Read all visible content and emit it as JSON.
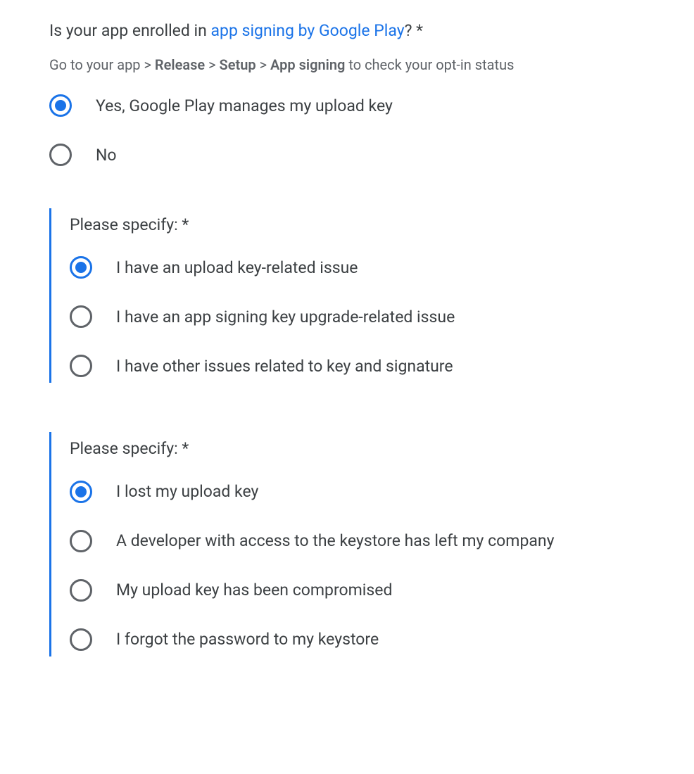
{
  "question1": {
    "title_prefix": "Is your app enrolled in ",
    "title_link": "app signing by Google Play",
    "title_suffix": "? *",
    "hint_prefix": "Go to your app > ",
    "hint_bold1": "Release",
    "hint_sep1": " > ",
    "hint_bold2": "Setup",
    "hint_sep2": " > ",
    "hint_bold3": "App signing",
    "hint_suffix": " to check your opt-in status",
    "options": [
      {
        "label": "Yes, Google Play manages my upload key",
        "selected": true
      },
      {
        "label": "No",
        "selected": false
      }
    ]
  },
  "question2": {
    "title": "Please specify: *",
    "options": [
      {
        "label": "I have an upload key-related issue",
        "selected": true
      },
      {
        "label": "I have an app signing key upgrade-related issue",
        "selected": false
      },
      {
        "label": "I have other issues related to key and signature",
        "selected": false
      }
    ]
  },
  "question3": {
    "title": "Please specify: *",
    "options": [
      {
        "label": "I lost my upload key",
        "selected": true
      },
      {
        "label": "A developer with access to the keystore has left my company",
        "selected": false
      },
      {
        "label": "My upload key has been compromised",
        "selected": false
      },
      {
        "label": "I forgot the password to my keystore",
        "selected": false
      }
    ]
  }
}
